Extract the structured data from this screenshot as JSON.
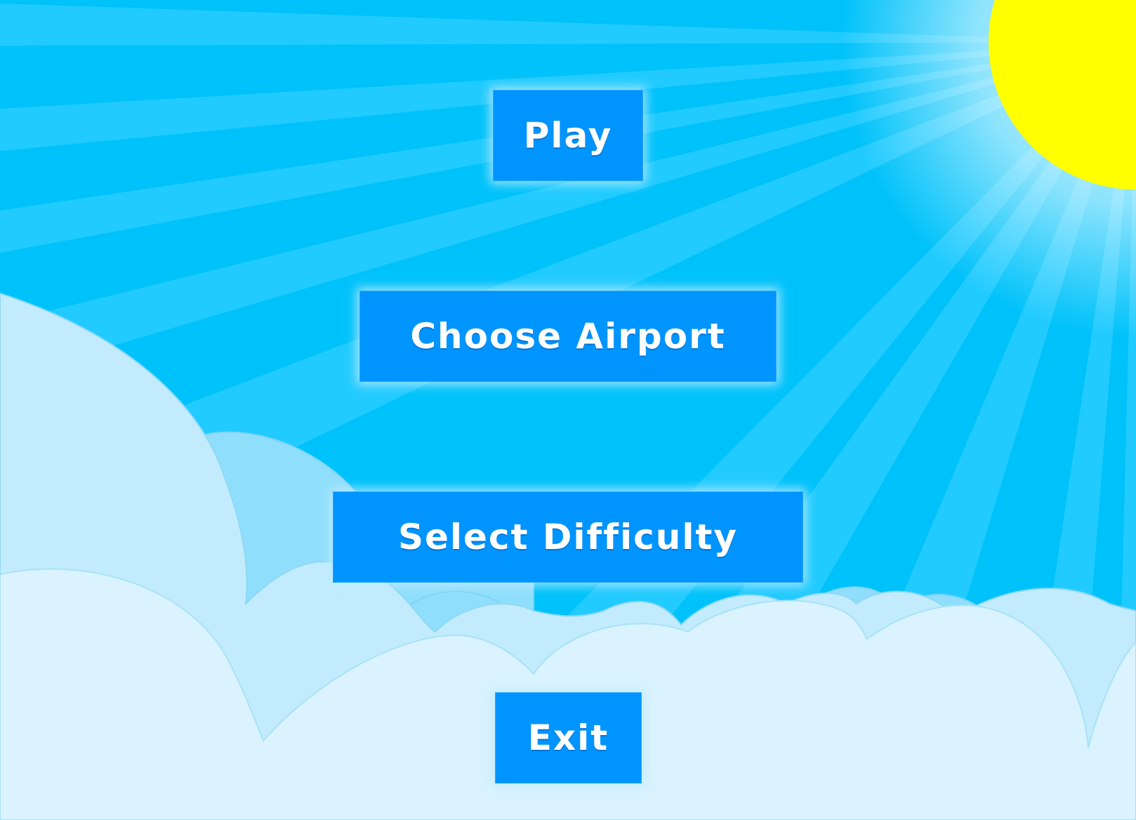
{
  "menu": {
    "play_label": "Play",
    "choose_airport_label": "Choose Airport",
    "select_difficulty_label": "Select Difficulty",
    "exit_label": "Exit"
  },
  "colors": {
    "sky": "#00c2fa",
    "sky_ray": "#22cbff",
    "sun": "#ffff00",
    "button": "#0094ff",
    "cloud_back": "#8fdffc",
    "cloud_mid": "#c2ecfd",
    "cloud_front": "#daf3fe",
    "cloud_outline": "#7fd3f5"
  }
}
